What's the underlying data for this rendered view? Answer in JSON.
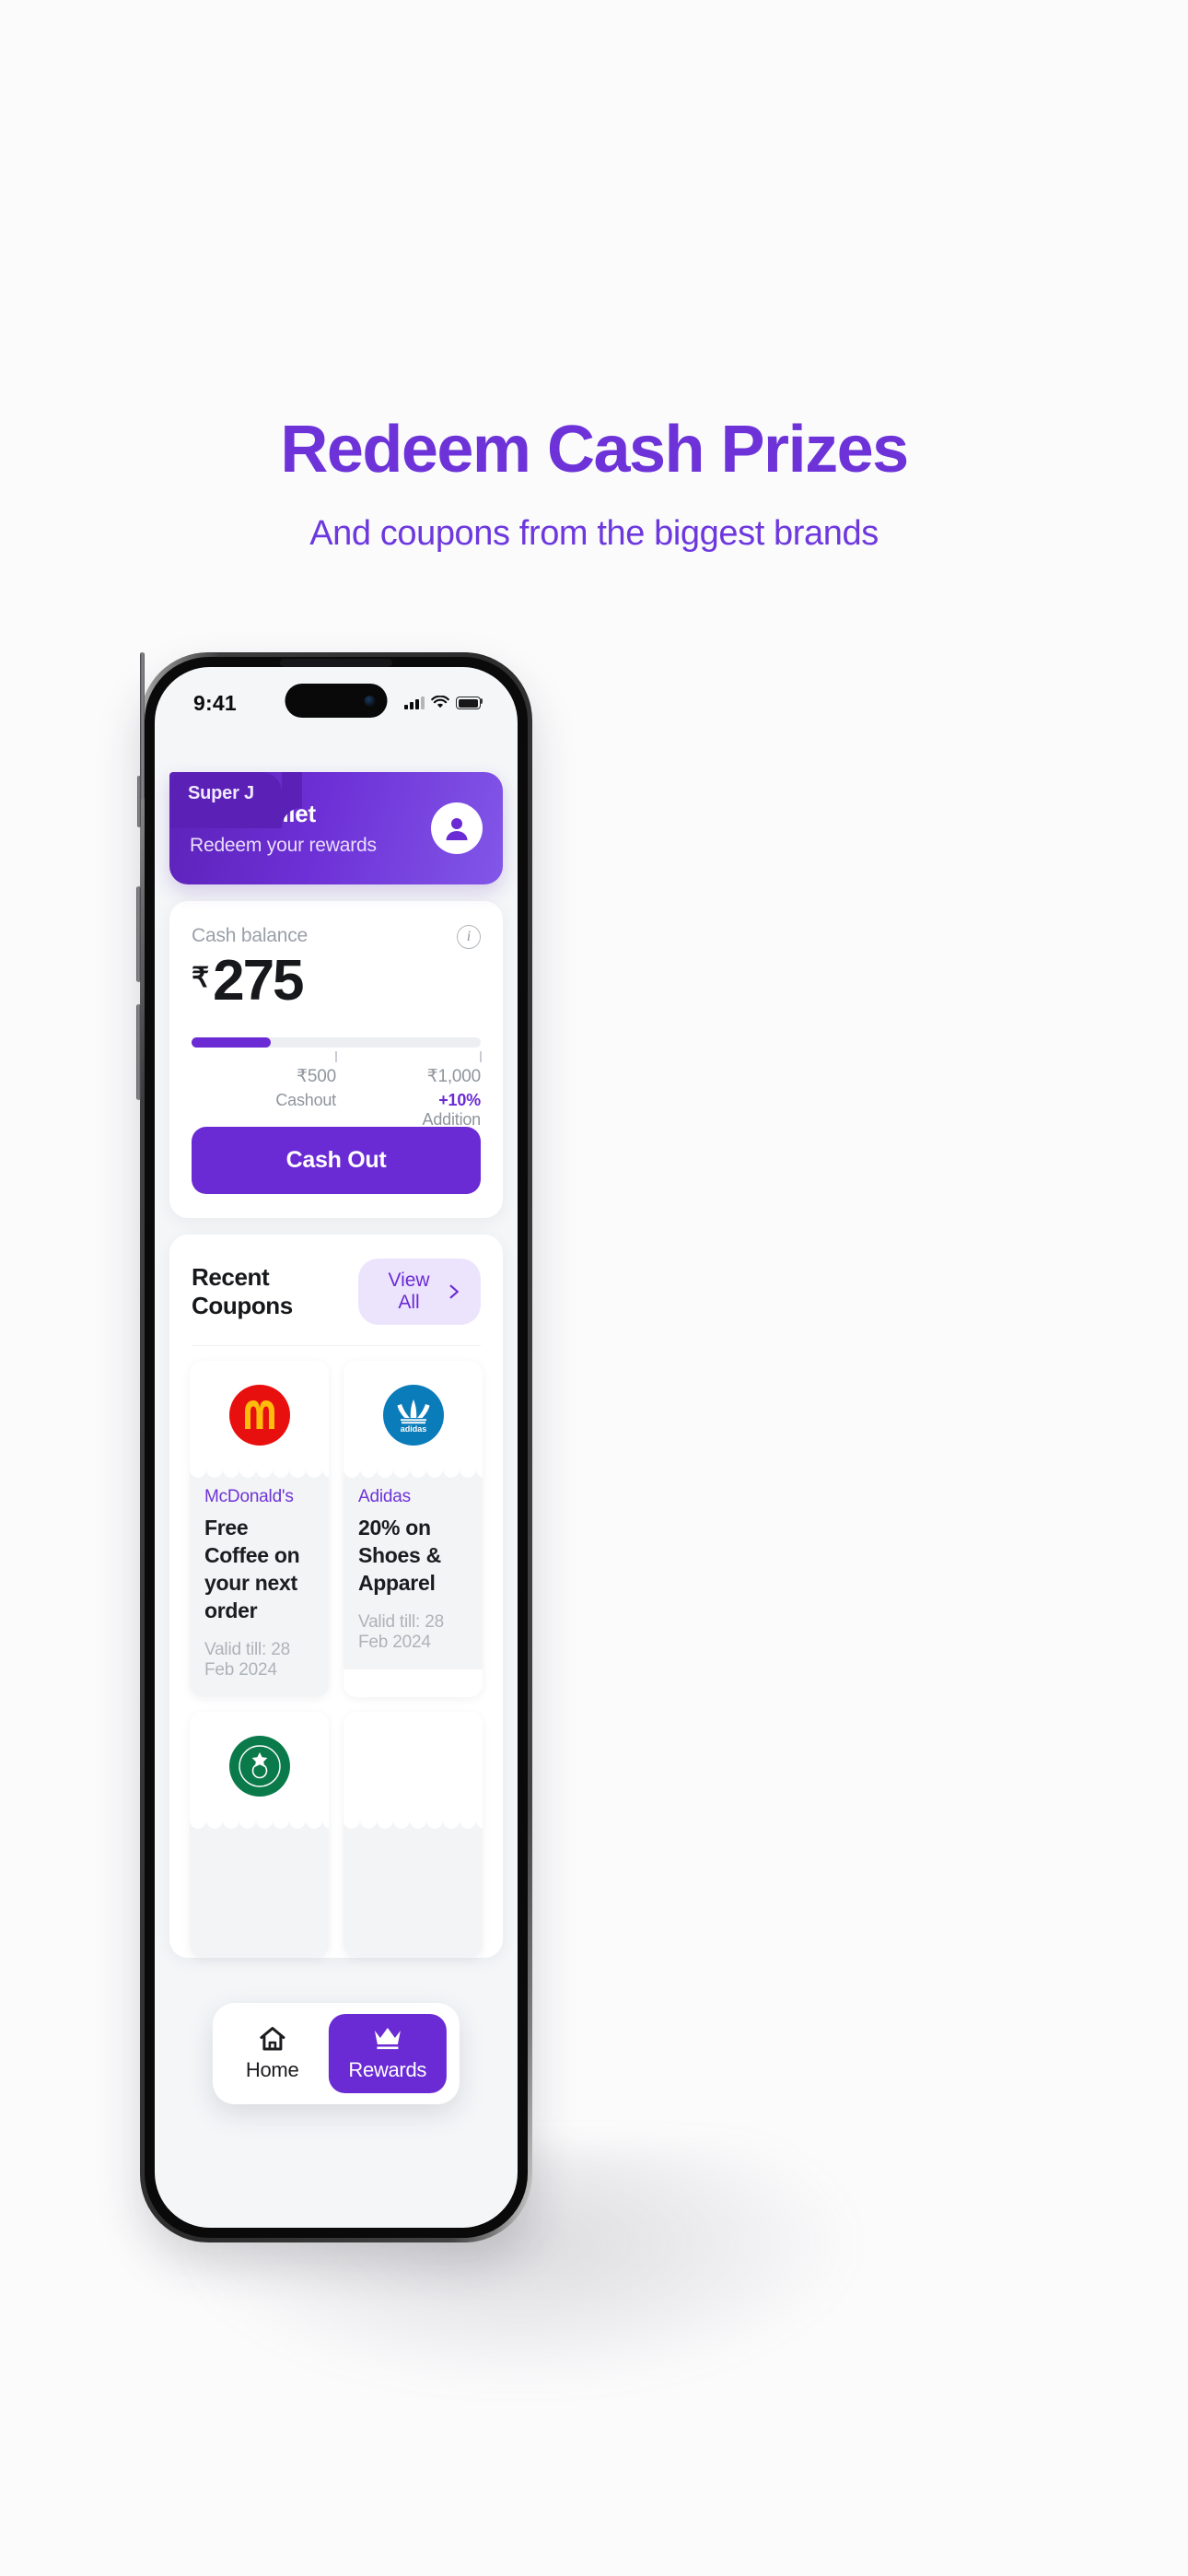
{
  "promo": {
    "title": "Redeem Cash Prizes",
    "subtitle": "And coupons from the biggest brands",
    "accent": "#6d33d8"
  },
  "status_bar": {
    "time": "9:41",
    "signal_icon": "cellular-signal-icon",
    "wifi_icon": "wifi-icon",
    "battery_icon": "battery-full-icon"
  },
  "wallet": {
    "tab_label": "Super J",
    "title": "Your Wallet",
    "subtitle": "Redeem your rewards",
    "avatar_icon": "user-avatar-icon",
    "gradient_from": "#5c22b8",
    "gradient_to": "#8257e8"
  },
  "balance": {
    "label": "Cash balance",
    "info_icon": "info-icon",
    "currency": "₹",
    "amount": "275",
    "progress_percent": 27.5,
    "bar_color": "#6a2ad4",
    "milestones": [
      {
        "position_percent": 50,
        "amount": "₹500",
        "note_strong": "",
        "note": "Cashout"
      },
      {
        "position_percent": 100,
        "amount": "₹1,000",
        "note_strong": "+10%",
        "note": "Addition"
      }
    ],
    "cash_out_label": "Cash Out"
  },
  "coupons": {
    "section_title": "Recent Coupons",
    "view_all_label": "View All",
    "view_all_icon": "chevron-right-icon",
    "items": [
      {
        "brand": "McDonald's",
        "description": "Free Coffee on your next order",
        "valid_label": "Valid till:",
        "valid_date": "28 Feb 2024",
        "logo_icon": "mcdonalds-logo-icon",
        "logo_bg": "#e8100f",
        "logo_fg": "#ffbc0d"
      },
      {
        "brand": "Adidas",
        "description": "20% on Shoes & Apparel",
        "valid_label": "Valid till:",
        "valid_date": "28 Feb 2024",
        "logo_icon": "adidas-logo-icon",
        "logo_bg": "#0b7cba",
        "logo_fg": "#ffffff"
      },
      {
        "brand": "Starbucks",
        "description": "",
        "valid_label": "",
        "valid_date": "",
        "logo_icon": "starbucks-logo-icon",
        "logo_bg": "#0b7a4b",
        "logo_fg": "#ffffff"
      },
      {
        "brand": "",
        "description": "",
        "valid_label": "",
        "valid_date": "",
        "logo_icon": "",
        "logo_bg": "#ffffff",
        "logo_fg": "#ffffff"
      }
    ]
  },
  "bottom_nav": {
    "items": [
      {
        "label": "Home",
        "icon": "home-icon",
        "active": false
      },
      {
        "label": "Rewards",
        "icon": "crown-icon",
        "active": true
      }
    ],
    "active_color": "#6a2ad4"
  }
}
